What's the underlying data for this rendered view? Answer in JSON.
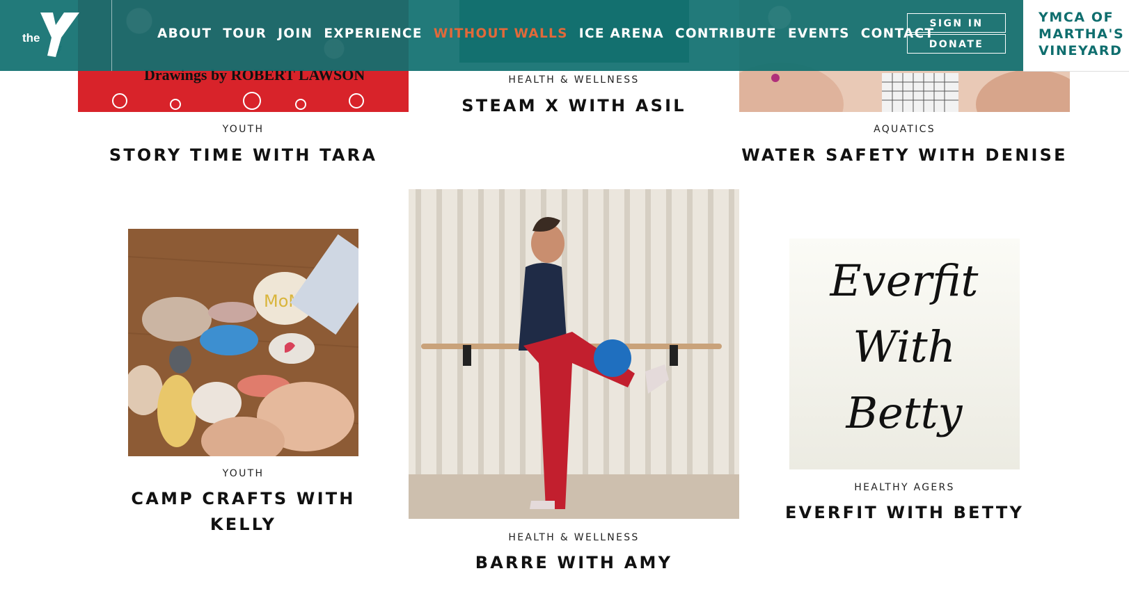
{
  "header": {
    "logo_text": "the",
    "logo_mark_text": "YMCA",
    "nav": [
      {
        "label": "ABOUT"
      },
      {
        "label": "TOUR"
      },
      {
        "label": "JOIN"
      },
      {
        "label": "EXPERIENCE"
      },
      {
        "label": "WITHOUT WALLS",
        "active": true
      },
      {
        "label": "ICE ARENA"
      },
      {
        "label": "CONTRIBUTE"
      },
      {
        "label": "EVENTS"
      },
      {
        "label": "CONTACT"
      }
    ],
    "sign_in": "SIGN IN",
    "donate": "DONATE",
    "brand_lines": [
      "YMCA OF",
      "MARTHA'S",
      "VINEYARD"
    ],
    "accent_color": "#117070",
    "active_color": "#e2693a"
  },
  "cards": [
    {
      "category": "YOUTH",
      "title": "STORY TIME WITH TARA",
      "image_text": "Drawings by ROBERT LAWSON"
    },
    {
      "category": "HEALTH & WELLNESS",
      "title": "STEAM X WITH ASIL"
    },
    {
      "category": "AQUATICS",
      "title": "WATER SAFETY WITH DENISE"
    },
    {
      "category": "YOUTH",
      "title_lines": [
        "CAMP CRAFTS WITH",
        "KELLY"
      ],
      "image_text": "MoM"
    },
    {
      "category": "HEALTH & WELLNESS",
      "title": "BARRE WITH AMY"
    },
    {
      "category": "HEALTHY AGERS",
      "title": "EVERFIT WITH BETTY",
      "image_lines": [
        "Everfit",
        "With",
        "Betty"
      ]
    }
  ]
}
